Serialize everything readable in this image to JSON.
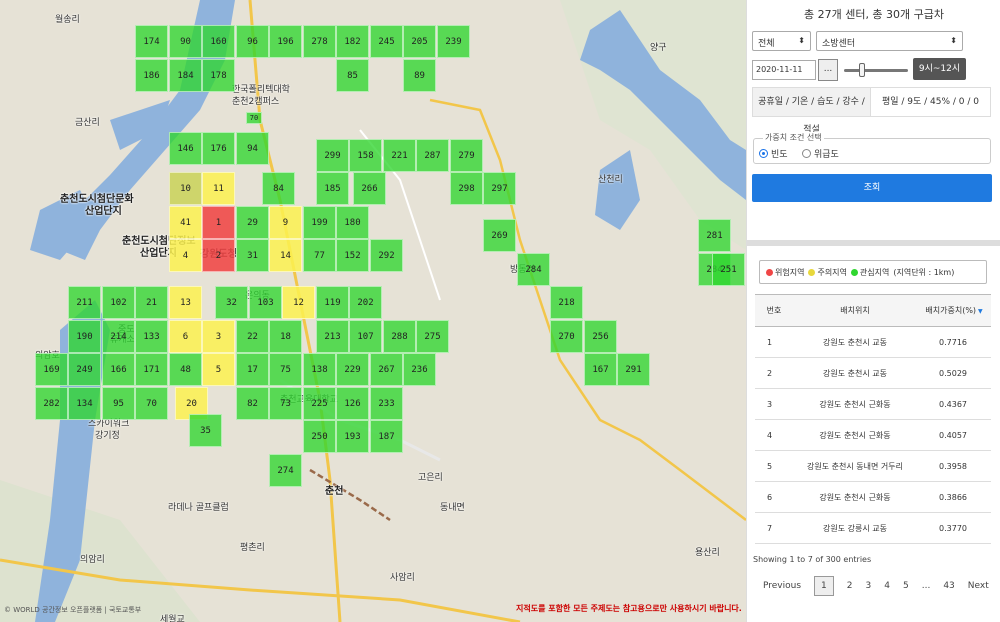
{
  "map": {
    "places": [
      {
        "text": "월송리",
        "style": "normal"
      },
      {
        "text": "한국폴리텍대학",
        "style": "normal"
      },
      {
        "text": "춘천2캠퍼스",
        "style": "normal"
      },
      {
        "text": "금산리",
        "style": "normal"
      },
      {
        "text": "춘천도시첨단문화",
        "style": "bold"
      },
      {
        "text": "산업단지",
        "style": "bold"
      },
      {
        "text": "춘천도시첨단정보",
        "style": "bold"
      },
      {
        "text": "산업단지",
        "style": "bold"
      },
      {
        "text": "강원도청",
        "style": "bold"
      },
      {
        "text": "온의동",
        "style": "normal"
      },
      {
        "text": "중도",
        "style": "normal"
      },
      {
        "text": "휴게소",
        "style": "normal"
      },
      {
        "text": "의암호",
        "style": "normal"
      },
      {
        "text": "스카이워크",
        "style": "normal"
      },
      {
        "text": "강기정",
        "style": "normal"
      },
      {
        "text": "춘천교육대학교",
        "style": "normal"
      },
      {
        "text": "춘천",
        "style": "bold"
      },
      {
        "text": "라데나 골프클럽",
        "style": "normal"
      },
      {
        "text": "평촌리",
        "style": "normal"
      },
      {
        "text": "고은리",
        "style": "normal"
      },
      {
        "text": "동내면",
        "style": "normal"
      },
      {
        "text": "사암리",
        "style": "normal"
      },
      {
        "text": "의암리",
        "style": "normal"
      },
      {
        "text": "용산리",
        "style": "normal"
      },
      {
        "text": "세월교",
        "style": "normal"
      },
      {
        "text": "방동리",
        "style": "normal"
      },
      {
        "text": "산천리",
        "style": "normal"
      },
      {
        "text": "양구",
        "style": "normal"
      }
    ],
    "grid_cells": [
      {
        "label": "174",
        "level": "green"
      },
      {
        "label": "90",
        "level": "green"
      },
      {
        "label": "160",
        "level": "green"
      },
      {
        "label": "96",
        "level": "green"
      },
      {
        "label": "196",
        "level": "green"
      },
      {
        "label": "278",
        "level": "green"
      },
      {
        "label": "182",
        "level": "green"
      },
      {
        "label": "245",
        "level": "green"
      },
      {
        "label": "205",
        "level": "green"
      },
      {
        "label": "239",
        "level": "green"
      },
      {
        "label": "186",
        "level": "green"
      },
      {
        "label": "184",
        "level": "green"
      },
      {
        "label": "178",
        "level": "green"
      },
      {
        "label": "85",
        "level": "green"
      },
      {
        "label": "89",
        "level": "green"
      },
      {
        "label": "70",
        "level": "green"
      },
      {
        "label": "146",
        "level": "green"
      },
      {
        "label": "176",
        "level": "green"
      },
      {
        "label": "94",
        "level": "green"
      },
      {
        "label": "299",
        "level": "green"
      },
      {
        "label": "158",
        "level": "green"
      },
      {
        "label": "221",
        "level": "green"
      },
      {
        "label": "287",
        "level": "green"
      },
      {
        "label": "279",
        "level": "green"
      },
      {
        "label": "10",
        "level": "olive"
      },
      {
        "label": "11",
        "level": "yellow"
      },
      {
        "label": "84",
        "level": "green"
      },
      {
        "label": "185",
        "level": "green"
      },
      {
        "label": "266",
        "level": "green"
      },
      {
        "label": "298",
        "level": "green"
      },
      {
        "label": "297",
        "level": "green"
      },
      {
        "label": "41",
        "level": "yellow"
      },
      {
        "label": "1",
        "level": "red"
      },
      {
        "label": "29",
        "level": "green"
      },
      {
        "label": "9",
        "level": "yellow"
      },
      {
        "label": "199",
        "level": "green"
      },
      {
        "label": "180",
        "level": "green"
      },
      {
        "label": "269",
        "level": "green"
      },
      {
        "label": "281",
        "level": "green"
      },
      {
        "label": "4",
        "level": "yellow"
      },
      {
        "label": "2",
        "level": "red"
      },
      {
        "label": "31",
        "level": "green"
      },
      {
        "label": "14",
        "level": "yellow"
      },
      {
        "label": "77",
        "level": "green"
      },
      {
        "label": "152",
        "level": "green"
      },
      {
        "label": "292",
        "level": "green"
      },
      {
        "label": "284",
        "level": "green"
      },
      {
        "label": "284",
        "level": "green"
      },
      {
        "label": "251",
        "level": "green"
      },
      {
        "label": "211",
        "level": "green"
      },
      {
        "label": "102",
        "level": "green"
      },
      {
        "label": "21",
        "level": "green"
      },
      {
        "label": "13",
        "level": "yellow"
      },
      {
        "label": "32",
        "level": "green"
      },
      {
        "label": "103",
        "level": "green"
      },
      {
        "label": "12",
        "level": "yellow"
      },
      {
        "label": "119",
        "level": "green"
      },
      {
        "label": "202",
        "level": "green"
      },
      {
        "label": "218",
        "level": "green"
      },
      {
        "label": "190",
        "level": "green"
      },
      {
        "label": "214",
        "level": "green"
      },
      {
        "label": "133",
        "level": "green"
      },
      {
        "label": "6",
        "level": "yellow"
      },
      {
        "label": "3",
        "level": "yellow"
      },
      {
        "label": "22",
        "level": "green"
      },
      {
        "label": "18",
        "level": "green"
      },
      {
        "label": "213",
        "level": "green"
      },
      {
        "label": "107",
        "level": "green"
      },
      {
        "label": "288",
        "level": "green"
      },
      {
        "label": "275",
        "level": "green"
      },
      {
        "label": "270",
        "level": "green"
      },
      {
        "label": "256",
        "level": "green"
      },
      {
        "label": "169",
        "level": "green"
      },
      {
        "label": "249",
        "level": "green"
      },
      {
        "label": "166",
        "level": "green"
      },
      {
        "label": "171",
        "level": "green"
      },
      {
        "label": "48",
        "level": "green"
      },
      {
        "label": "5",
        "level": "yellow"
      },
      {
        "label": "17",
        "level": "green"
      },
      {
        "label": "75",
        "level": "green"
      },
      {
        "label": "138",
        "level": "green"
      },
      {
        "label": "229",
        "level": "green"
      },
      {
        "label": "267",
        "level": "green"
      },
      {
        "label": "236",
        "level": "green"
      },
      {
        "label": "167",
        "level": "green"
      },
      {
        "label": "291",
        "level": "green"
      },
      {
        "label": "282",
        "level": "green"
      },
      {
        "label": "134",
        "level": "green"
      },
      {
        "label": "95",
        "level": "green"
      },
      {
        "label": "70",
        "level": "green"
      },
      {
        "label": "20",
        "level": "yellow"
      },
      {
        "label": "35",
        "level": "green"
      },
      {
        "label": "82",
        "level": "green"
      },
      {
        "label": "73",
        "level": "green"
      },
      {
        "label": "225",
        "level": "green"
      },
      {
        "label": "126",
        "level": "green"
      },
      {
        "label": "233",
        "level": "green"
      },
      {
        "label": "250",
        "level": "green"
      },
      {
        "label": "193",
        "level": "green"
      },
      {
        "label": "187",
        "level": "green"
      },
      {
        "label": "274",
        "level": "green"
      }
    ],
    "road_numbers": [
      "70",
      "46",
      "70"
    ],
    "notice": "지적도를 포함한 모든 주제도는 참고용으로만 사용하시기 바랍니다.",
    "copyright": "© WORLD 공간정보 오픈플랫폼 | 국토교통부"
  },
  "panel": {
    "title": "총 27개 센터, 총 30개 구급차",
    "region_select": "전체",
    "center_select": "소방센터",
    "date": "2020-11-11",
    "date_button": "...",
    "time_range": "9시~12시",
    "slider_level": 0.28,
    "tab_conditions": "공휴일 / 기온 / 습도 / 강수 / 적설",
    "tab_values": "평일 / 9도 / 45% / 0 / 0",
    "weight_legend": "가중치 조건 선택",
    "radio_frequency": "빈도",
    "radio_severity": "위급도",
    "search_button": "조회",
    "legend": {
      "danger": "위험지역",
      "caution": "주의지역",
      "interest": "관심지역",
      "unit": "(지역단위 : 1km)"
    },
    "colors": {
      "danger": "#f04646",
      "caution": "#fcf150",
      "interest": "#30d630",
      "accent": "#1f7ae0"
    },
    "table": {
      "headers": [
        "번호",
        "배치위치",
        "배치가중치(%)"
      ],
      "rows": [
        [
          "1",
          "강원도 춘천시 교동",
          "0.7716"
        ],
        [
          "2",
          "강원도 춘천시 교동",
          "0.5029"
        ],
        [
          "3",
          "강원도 춘천시 근화동",
          "0.4367"
        ],
        [
          "4",
          "강원도 춘천시 근화동",
          "0.4057"
        ],
        [
          "5",
          "강원도 춘천시 동내면 거두리",
          "0.3958"
        ],
        [
          "6",
          "강원도 춘천시 근화동",
          "0.3866"
        ],
        [
          "7",
          "강원도 강릉시 교동",
          "0.3770"
        ]
      ]
    },
    "entries": "Showing 1 to 7 of 300 entries",
    "pager": [
      "Previous",
      "1",
      "2",
      "3",
      "4",
      "5",
      "...",
      "43",
      "Next"
    ]
  }
}
